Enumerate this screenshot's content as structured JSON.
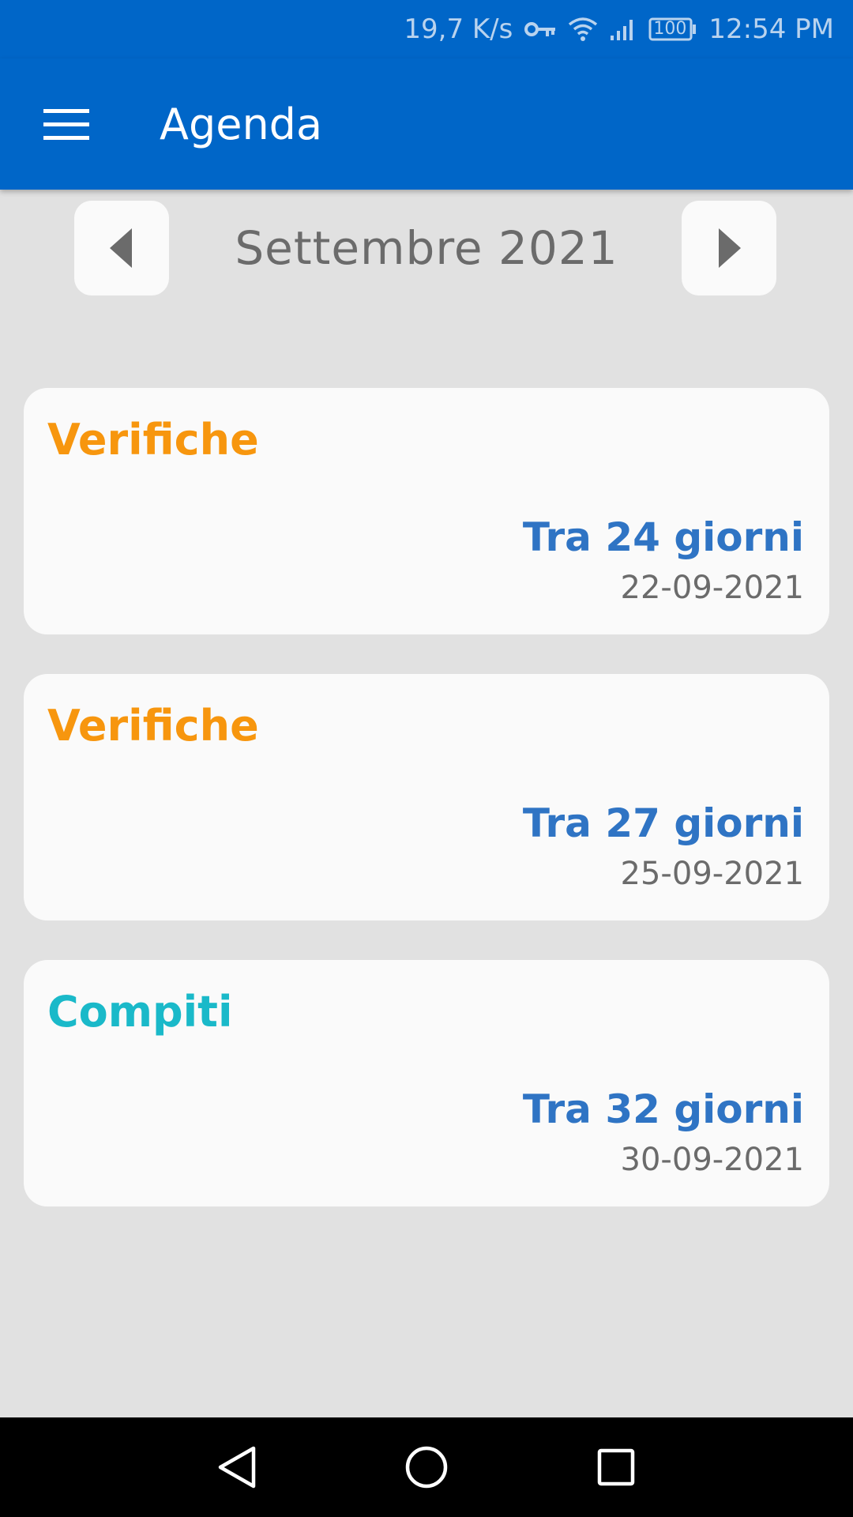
{
  "status": {
    "speed": "19,7 K/s",
    "battery": "100",
    "time": "12:54 PM",
    "icons": [
      "key-icon",
      "wifi-icon",
      "signal-icon",
      "battery-icon"
    ]
  },
  "app_bar": {
    "title": "Agenda",
    "menu_icon": "hamburger-menu-icon",
    "color": "#0066c8"
  },
  "month_nav": {
    "label": "Settembre 2021",
    "prev_icon": "triangle-left-icon",
    "next_icon": "triangle-right-icon"
  },
  "events": [
    {
      "type": "Verifiche",
      "color": "#f7960e",
      "relative": "Tra 24 giorni",
      "date": "22-09-2021"
    },
    {
      "type": "Verifiche",
      "color": "#f7960e",
      "relative": "Tra 27 giorni",
      "date": "25-09-2021"
    },
    {
      "type": "Compiti",
      "color": "#1ab9c9",
      "relative": "Tra 32 giorni",
      "date": "30-09-2021"
    }
  ],
  "system_nav": {
    "icons": [
      "back-icon",
      "home-icon",
      "recents-icon"
    ]
  }
}
